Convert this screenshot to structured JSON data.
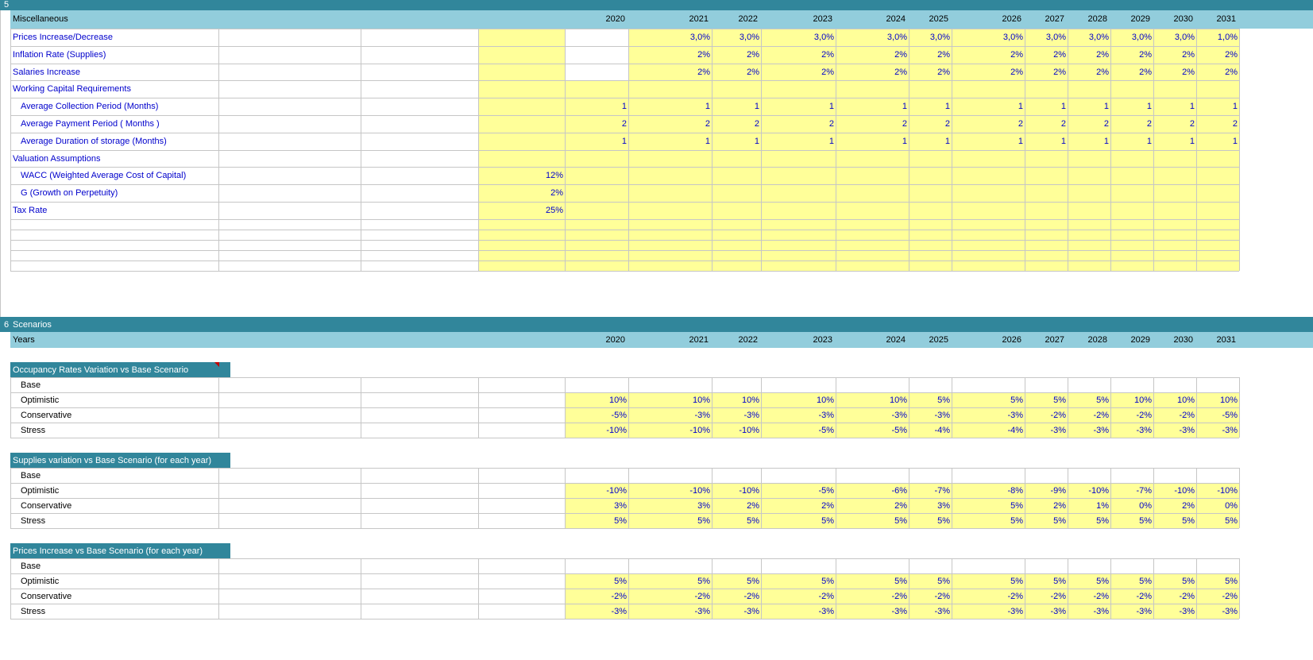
{
  "section5": {
    "number": "5"
  },
  "section6": {
    "number": "6",
    "title": "Scenarios"
  },
  "years": [
    "2020",
    "2021",
    "2022",
    "2023",
    "2024",
    "2025",
    "2026",
    "2027",
    "2028",
    "2029",
    "2030",
    "2031"
  ],
  "misc": {
    "header": "Miscellaneous",
    "rows": [
      {
        "label": "Prices Increase/Decrease",
        "indent": false,
        "input": "",
        "values": [
          "",
          "3,0%",
          "3,0%",
          "3,0%",
          "3,0%",
          "3,0%",
          "3,0%",
          "3,0%",
          "3,0%",
          "3,0%",
          "3,0%",
          "1,0%"
        ]
      },
      {
        "label": "Inflation Rate (Supplies)",
        "indent": false,
        "input": "",
        "values": [
          "",
          "2%",
          "2%",
          "2%",
          "2%",
          "2%",
          "2%",
          "2%",
          "2%",
          "2%",
          "2%",
          "2%"
        ]
      },
      {
        "label": "Salaries Increase",
        "indent": false,
        "input": "",
        "values": [
          "",
          "2%",
          "2%",
          "2%",
          "2%",
          "2%",
          "2%",
          "2%",
          "2%",
          "2%",
          "2%",
          "2%"
        ]
      },
      {
        "label": "Working Capital Requirements",
        "indent": false,
        "input": "",
        "values": [
          "",
          "",
          "",
          "",
          "",
          "",
          "",
          "",
          "",
          "",
          "",
          ""
        ]
      },
      {
        "label": "Average Collection Period (Months)",
        "indent": true,
        "input": "",
        "values": [
          "1",
          "1",
          "1",
          "1",
          "1",
          "1",
          "1",
          "1",
          "1",
          "1",
          "1",
          "1"
        ]
      },
      {
        "label": "Average Payment Period ( Months )",
        "indent": true,
        "input": "",
        "values": [
          "2",
          "2",
          "2",
          "2",
          "2",
          "2",
          "2",
          "2",
          "2",
          "2",
          "2",
          "2"
        ]
      },
      {
        "label": "Average Duration of storage (Months)",
        "indent": true,
        "input": "",
        "values": [
          "1",
          "1",
          "1",
          "1",
          "1",
          "1",
          "1",
          "1",
          "1",
          "1",
          "1",
          "1"
        ]
      },
      {
        "label": "Valuation Assumptions",
        "indent": false,
        "input": "",
        "values": [
          "",
          "",
          "",
          "",
          "",
          "",
          "",
          "",
          "",
          "",
          "",
          ""
        ]
      },
      {
        "label": "WACC (Weighted Average Cost of Capital)",
        "indent": true,
        "input": "12%",
        "values": [
          "",
          "",
          "",
          "",
          "",
          "",
          "",
          "",
          "",
          "",
          "",
          ""
        ]
      },
      {
        "label": "G (Growth on Perpetuity)",
        "indent": true,
        "input": "2%",
        "values": [
          "",
          "",
          "",
          "",
          "",
          "",
          "",
          "",
          "",
          "",
          "",
          ""
        ]
      },
      {
        "label": "Tax Rate",
        "indent": false,
        "input": "25%",
        "values": [
          "",
          "",
          "",
          "",
          "",
          "",
          "",
          "",
          "",
          "",
          "",
          ""
        ]
      }
    ]
  },
  "scenarios": {
    "header": "Years",
    "groups": [
      {
        "title": "Occupancy Rates Variation vs Base Scenario",
        "rows": [
          {
            "label": "Base",
            "values": []
          },
          {
            "label": "Optimistic",
            "values": [
              "10%",
              "10%",
              "10%",
              "10%",
              "10%",
              "5%",
              "5%",
              "5%",
              "5%",
              "10%",
              "10%",
              "10%"
            ]
          },
          {
            "label": "Conservative",
            "values": [
              "-5%",
              "-3%",
              "-3%",
              "-3%",
              "-3%",
              "-3%",
              "-3%",
              "-2%",
              "-2%",
              "-2%",
              "-2%",
              "-5%"
            ]
          },
          {
            "label": "Stress",
            "values": [
              "-10%",
              "-10%",
              "-10%",
              "-5%",
              "-5%",
              "-4%",
              "-4%",
              "-3%",
              "-3%",
              "-3%",
              "-3%",
              "-3%"
            ]
          }
        ]
      },
      {
        "title": "Supplies variation vs Base Scenario  (for each year)",
        "rows": [
          {
            "label": "Base",
            "values": []
          },
          {
            "label": "Optimistic",
            "values": [
              "-10%",
              "-10%",
              "-10%",
              "-5%",
              "-6%",
              "-7%",
              "-8%",
              "-9%",
              "-10%",
              "-7%",
              "-10%",
              "-10%"
            ]
          },
          {
            "label": "Conservative",
            "values": [
              "3%",
              "3%",
              "2%",
              "2%",
              "2%",
              "3%",
              "5%",
              "2%",
              "1%",
              "0%",
              "2%",
              "0%"
            ]
          },
          {
            "label": "Stress",
            "values": [
              "5%",
              "5%",
              "5%",
              "5%",
              "5%",
              "5%",
              "5%",
              "5%",
              "5%",
              "5%",
              "5%",
              "5%"
            ]
          }
        ]
      },
      {
        "title": "Prices Increase vs Base Scenario (for each year)",
        "rows": [
          {
            "label": "Base",
            "values": []
          },
          {
            "label": "Optimistic",
            "values": [
              "5%",
              "5%",
              "5%",
              "5%",
              "5%",
              "5%",
              "5%",
              "5%",
              "5%",
              "5%",
              "5%",
              "5%"
            ]
          },
          {
            "label": "Conservative",
            "values": [
              "-2%",
              "-2%",
              "-2%",
              "-2%",
              "-2%",
              "-2%",
              "-2%",
              "-2%",
              "-2%",
              "-2%",
              "-2%",
              "-2%"
            ]
          },
          {
            "label": "Stress",
            "values": [
              "-3%",
              "-3%",
              "-3%",
              "-3%",
              "-3%",
              "-3%",
              "-3%",
              "-3%",
              "-3%",
              "-3%",
              "-3%",
              "-3%"
            ]
          }
        ]
      }
    ]
  }
}
